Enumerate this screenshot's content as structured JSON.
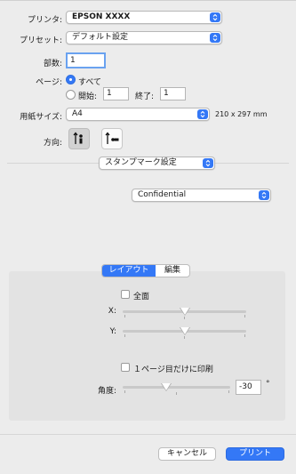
{
  "printer": {
    "label": "プリンタ:",
    "value": "EPSON XXXX"
  },
  "preset": {
    "label": "プリセット:",
    "value": "デフォルト設定"
  },
  "copies": {
    "label": "部数:",
    "value": "1"
  },
  "pages": {
    "label": "ページ:",
    "all_label": "すべて",
    "from_label": "開始:",
    "from_value": "1",
    "to_label": "終了:",
    "to_value": "1"
  },
  "paper_size": {
    "label": "用紙サイズ:",
    "value": "A4",
    "dims": "210 x 297 mm"
  },
  "orientation": {
    "label": "方向:"
  },
  "section_popup": {
    "value": "スタンプマーク設定"
  },
  "stamp_popup": {
    "value": "Confidential"
  },
  "tabs": {
    "layout": "レイアウト",
    "edit": "編集"
  },
  "layout_panel": {
    "all_pages_label": "全面",
    "x_label": "X:",
    "y_label": "Y:",
    "first_page_only_label": "１ページ目だけに印刷",
    "angle_label": "角度:",
    "angle_value": "-30",
    "angle_unit": "°"
  },
  "buttons": {
    "cancel": "キャンセル",
    "print": "プリント"
  },
  "colors": {
    "accent": "#3478f6",
    "window_bg": "#ececec",
    "panel_bg": "#e3e3e3"
  }
}
